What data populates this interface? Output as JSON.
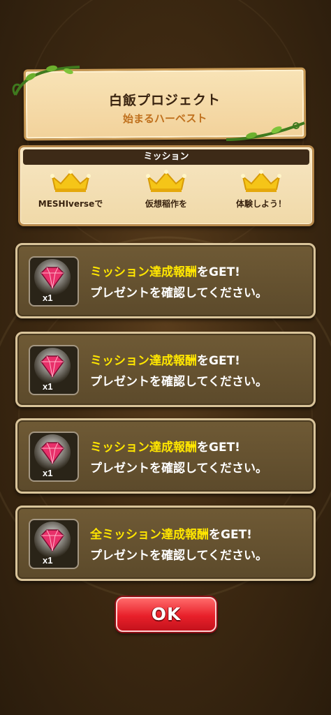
{
  "banner": {
    "title": "白飯プロジェクト",
    "subtitle": "始まるハーベスト"
  },
  "mission": {
    "header": "ミッション",
    "items": [
      {
        "label": "MESHIverseで",
        "icon": "crown-icon"
      },
      {
        "label": "仮想稲作を",
        "icon": "crown-icon"
      },
      {
        "label": "体験しよう！",
        "icon": "crown-icon"
      }
    ]
  },
  "rewards": [
    {
      "highlight": "ミッション達成報酬",
      "tail": "をGET!",
      "line2": "プレゼントを確認してください。",
      "qty": "x1",
      "icon": "gem-icon"
    },
    {
      "highlight": "ミッション達成報酬",
      "tail": "をGET!",
      "line2": "プレゼントを確認してください。",
      "qty": "x1",
      "icon": "gem-icon"
    },
    {
      "highlight": "ミッション達成報酬",
      "tail": "をGET!",
      "line2": "プレゼントを確認してください。",
      "qty": "x1",
      "icon": "gem-icon"
    },
    {
      "highlight": "全ミッション達成報酬",
      "tail": "をGET!",
      "line2": "プレゼントを確認してください。",
      "qty": "x1",
      "icon": "gem-icon"
    }
  ],
  "ok_label": "OK",
  "colors": {
    "highlight": "#ffe600",
    "ok_button": "#e8202a",
    "panel": "#5c4a2b"
  }
}
